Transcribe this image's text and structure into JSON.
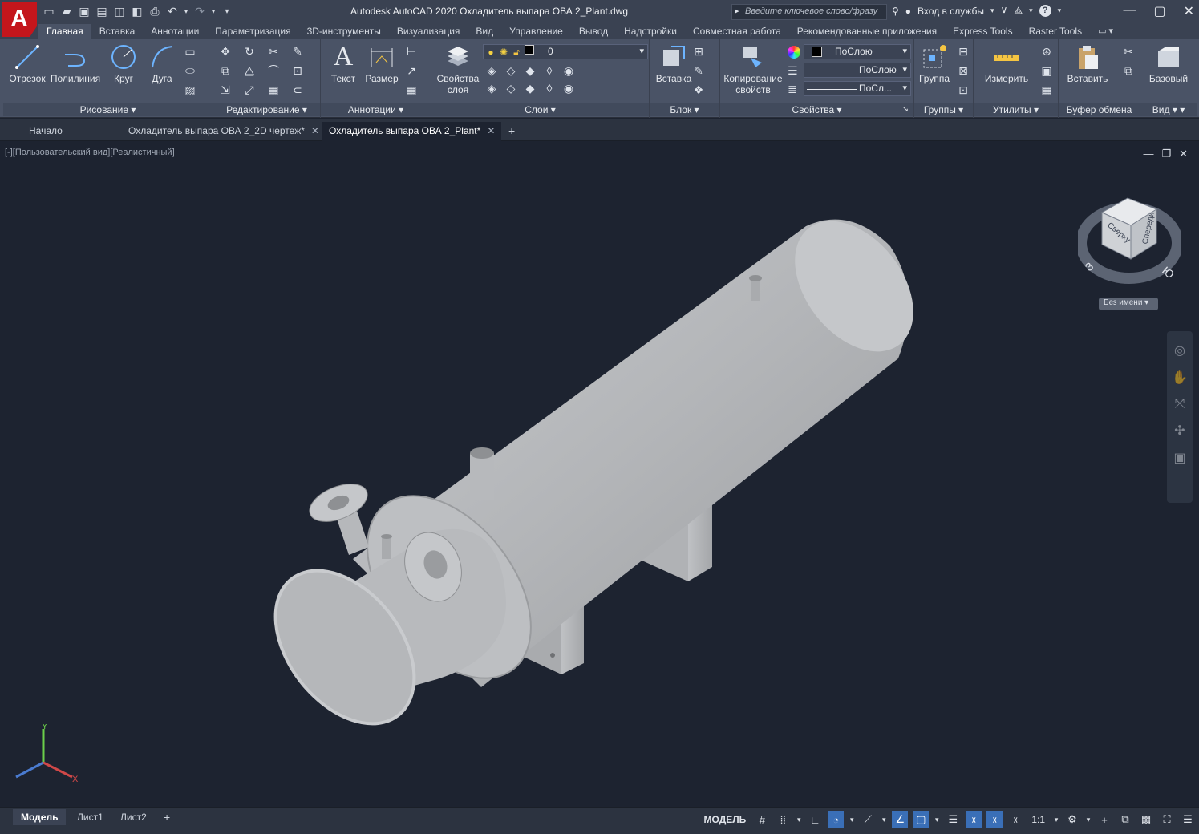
{
  "app": {
    "logo_letter": "A",
    "title": "Autodesk AutoCAD 2020   Охладитель выпара ОВА 2_Plant.dwg",
    "search_placeholder": "Введите ключевое слово/фразу",
    "signin": "Вход в службы",
    "colors": {
      "titlebar": "#3a4252",
      "ribbon": "#4a5366",
      "canvas": "#1d2330",
      "accent": "#c4161c",
      "active_toggle": "#3a6fb7"
    }
  },
  "ribbon_tabs": [
    "Главная",
    "Вставка",
    "Аннотации",
    "Параметризация",
    "3D-инструменты",
    "Визуализация",
    "Вид",
    "Управление",
    "Вывод",
    "Надстройки",
    "Совместная работа",
    "Рекомендованные приложения",
    "Express Tools",
    "Raster Tools"
  ],
  "panels": {
    "draw": {
      "label": "Рисование",
      "buttons": [
        "Отрезок",
        "Полилиния",
        "Круг",
        "Дуга"
      ]
    },
    "modify": {
      "label": "Редактирование"
    },
    "annotation": {
      "label": "Аннотации",
      "buttons": [
        "Текст",
        "Размер"
      ]
    },
    "layers": {
      "label": "Слои",
      "button": "Свойства слоя",
      "current_layer": "0"
    },
    "block": {
      "label": "Блок",
      "button": "Вставка"
    },
    "properties": {
      "label": "Свойства",
      "button": "Копирование свойств",
      "color": "ПоСлою",
      "linetype": "ПоСлою",
      "lineweight": "ПоСл..."
    },
    "groups": {
      "label": "Группы",
      "button": "Группа"
    },
    "utilities": {
      "label": "Утилиты",
      "button": "Измерить"
    },
    "clipboard": {
      "label": "Буфер обмена",
      "button": "Вставить"
    },
    "view": {
      "label": "Вид",
      "button": "Базовый"
    }
  },
  "doc_tabs": [
    {
      "label": "Начало"
    },
    {
      "label": "Охладитель выпара ОВА 2_2D чертеж*"
    },
    {
      "label": "Охладитель выпара ОВА 2_Plant*"
    }
  ],
  "viewport": {
    "label": "[-][Пользовательский вид][Реалистичный]",
    "viewcube_top": "Сверху",
    "viewcube_front": "Спереди",
    "viewcube_named": "Без имени"
  },
  "layout_tabs": [
    "Модель",
    "Лист1",
    "Лист2"
  ],
  "status": {
    "model": "МОДЕЛЬ",
    "scale": "1:1"
  }
}
